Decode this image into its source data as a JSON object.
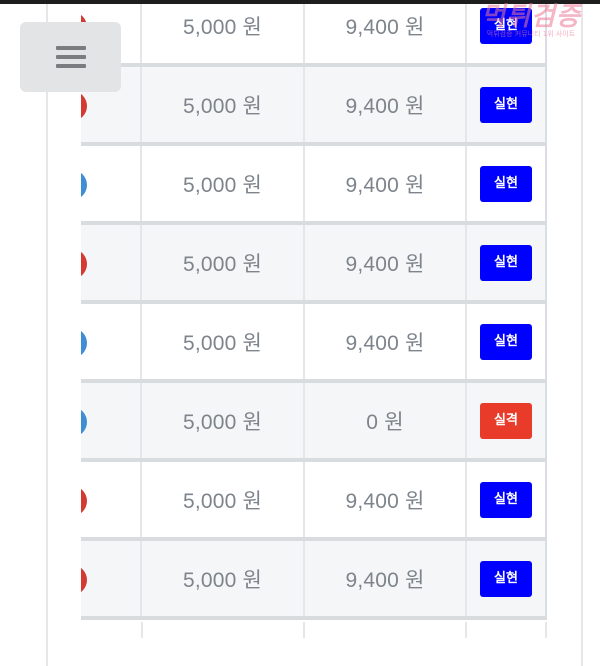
{
  "watermark": {
    "text": "먹튀검증",
    "subtext": "먹튀검증 커뮤니티 1위 사이트"
  },
  "menu": {
    "icon": "hamburger-menu-icon"
  },
  "colors": {
    "win_badge": "#0000ff",
    "lose_badge": "#e83b2a",
    "ball_red": "#d33a32",
    "ball_blue": "#3f8ed4"
  },
  "rows": [
    {
      "ball": "red",
      "bet": "5,000 원",
      "payout": "9,400 원",
      "result": "실현",
      "status": "win"
    },
    {
      "ball": "red",
      "bet": "5,000 원",
      "payout": "9,400 원",
      "result": "실현",
      "status": "win"
    },
    {
      "ball": "blue",
      "bet": "5,000 원",
      "payout": "9,400 원",
      "result": "실현",
      "status": "win"
    },
    {
      "ball": "red",
      "bet": "5,000 원",
      "payout": "9,400 원",
      "result": "실현",
      "status": "win"
    },
    {
      "ball": "blue",
      "bet": "5,000 원",
      "payout": "9,400 원",
      "result": "실현",
      "status": "win"
    },
    {
      "ball": "blue",
      "bet": "5,000 원",
      "payout": "0 원",
      "result": "실격",
      "status": "lose"
    },
    {
      "ball": "red",
      "bet": "5,000 원",
      "payout": "9,400 원",
      "result": "실현",
      "status": "win"
    },
    {
      "ball": "red",
      "bet": "5,000 원",
      "payout": "9,400 원",
      "result": "실현",
      "status": "win"
    }
  ]
}
